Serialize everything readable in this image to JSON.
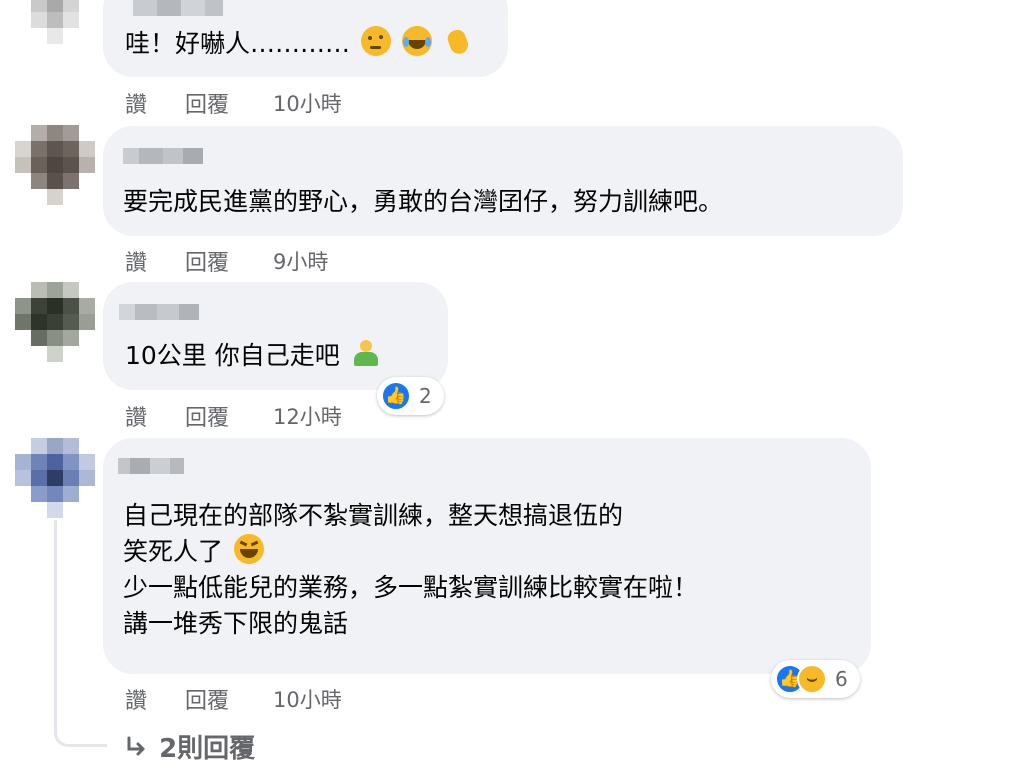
{
  "comments": [
    {
      "lines": [
        "哇！好嚇人…………"
      ],
      "actions": {
        "like": "讚",
        "reply": "回覆",
        "time": "10小時"
      },
      "emojis": [
        "thinking-face-icon",
        "crying-laughing-face-icon",
        "clapping-hands-icon"
      ]
    },
    {
      "lines": [
        "要完成民進黨的野心，勇敢的台灣囝仔，努力訓練吧。"
      ],
      "actions": {
        "like": "讚",
        "reply": "回覆",
        "time": "9小時"
      }
    },
    {
      "lines": [
        "10公里 你自己走吧"
      ],
      "actions": {
        "like": "讚",
        "reply": "回覆",
        "time": "12小時"
      },
      "emojis": [
        "person-shrugging-icon"
      ],
      "reaction_count": "2"
    },
    {
      "lines": [
        "自己現在的部隊不紮實訓練，整天想搞退伍的",
        "笑死人了",
        "少一點低能兒的業務，多一點紮實訓練比較實在啦！",
        "講一堆秀下限的鬼話"
      ],
      "actions": {
        "like": "讚",
        "reply": "回覆",
        "time": "10小時"
      },
      "emojis": [
        "grinning-squinting-face-icon"
      ],
      "reaction_count": "6"
    }
  ],
  "view_replies": "2則回覆",
  "colors": {
    "bubble": "#f0f2f5",
    "secondary_text": "#65676b",
    "like_blue": "#1877f2",
    "haha_yellow": "#f7b928"
  }
}
